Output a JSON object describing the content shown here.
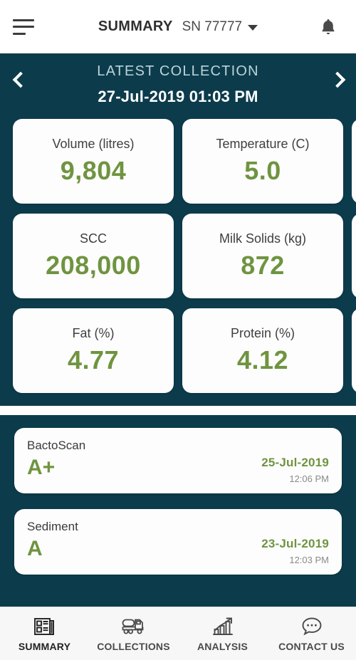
{
  "theme": {
    "teal": "#0c3c4c",
    "green": "#6f9440",
    "card": "#fdfdfd",
    "muted": "#bcd3da"
  },
  "appbar": {
    "menu_icon": "hamburger-icon",
    "title": "SUMMARY",
    "serial_number": "SN 77777",
    "dropdown_icon": "chevron-down-icon",
    "notifications_icon": "bell-icon"
  },
  "carousel": {
    "label": "LATEST COLLECTION",
    "date": "27-Jul-2019 01:03 PM",
    "prev_icon": "chevron-left-icon",
    "next_icon": "chevron-right-icon"
  },
  "metrics": [
    {
      "label": "Volume (litres)",
      "value": "9,804"
    },
    {
      "label": "Temperature (C)",
      "value": "5.0"
    },
    {
      "label": "SCC",
      "value": "208,000"
    },
    {
      "label": "Milk Solids (kg)",
      "value": "872"
    },
    {
      "label": "Fat (%)",
      "value": "4.77"
    },
    {
      "label": "Protein (%)",
      "value": "4.12"
    }
  ],
  "tests": [
    {
      "name": "BactoScan",
      "grade": "A+",
      "date": "25-Jul-2019",
      "time": "12:06 PM"
    },
    {
      "name": "Sediment",
      "grade": "A",
      "date": "23-Jul-2019",
      "time": "12:03 PM"
    }
  ],
  "bottom_nav": [
    {
      "label": "SUMMARY",
      "icon": "newspaper-icon",
      "active": true
    },
    {
      "label": "COLLECTIONS",
      "icon": "tanker-truck-icon",
      "active": false
    },
    {
      "label": "ANALYSIS",
      "icon": "bar-chart-trend-icon",
      "active": false
    },
    {
      "label": "CONTACT US",
      "icon": "chat-bubble-icon",
      "active": false
    }
  ]
}
